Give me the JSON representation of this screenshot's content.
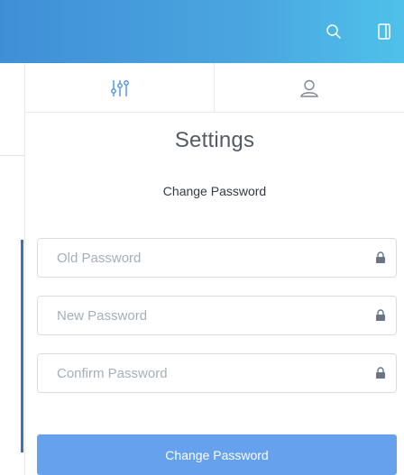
{
  "topbar": {
    "color_start": "#3f8fd6",
    "color_end": "#4fc1ea",
    "icons": [
      "search-icon",
      "sidebar-panel-icon"
    ]
  },
  "tabs": [
    {
      "icon": "sliders-icon",
      "active": true
    },
    {
      "icon": "user-icon",
      "active": false
    }
  ],
  "settings": {
    "title": "Settings",
    "subtitle": "Change Password",
    "fields": {
      "old_password": {
        "placeholder": "Old Password",
        "value": "",
        "icon": "lock-icon"
      },
      "new_password": {
        "placeholder": "New Password",
        "value": "",
        "icon": "lock-icon"
      },
      "confirm_password": {
        "placeholder": "Confirm Password",
        "value": "",
        "icon": "lock-icon"
      }
    },
    "submit_label": "Change Password",
    "button_color": "#65a1ec",
    "accent_color": "#4a90e2"
  }
}
